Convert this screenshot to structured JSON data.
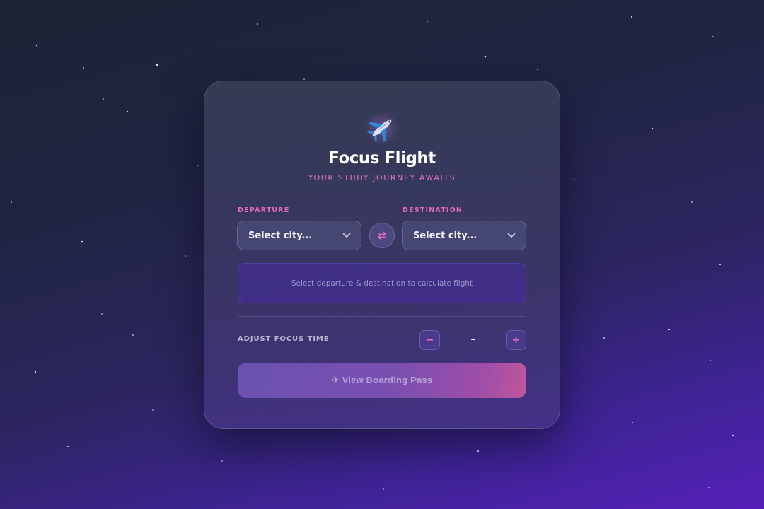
{
  "app": {
    "title": "Focus Flight",
    "subtitle": "YOUR STUDY JOURNEY AWAITS",
    "logo_icon": "airplane-icon"
  },
  "route": {
    "departure": {
      "label": "DEPARTURE",
      "value": "Select city..."
    },
    "destination": {
      "label": "DESTINATION",
      "value": "Select city..."
    },
    "swap_glyph": "⇄",
    "swap_icon": "swap-arrows-icon"
  },
  "info": {
    "message": "Select departure & destination to calculate flight"
  },
  "focus": {
    "label": "ADJUST FOCUS TIME",
    "decrement": "−",
    "value": "–",
    "increment": "+"
  },
  "boarding": {
    "label": "✈ View Boarding Pass"
  },
  "colors": {
    "accent_pink": "#e26bbe",
    "background_top": "#1b2436",
    "background_bottom": "#5520b8",
    "button_start": "#6a52b0",
    "button_end": "#c0569a"
  }
}
